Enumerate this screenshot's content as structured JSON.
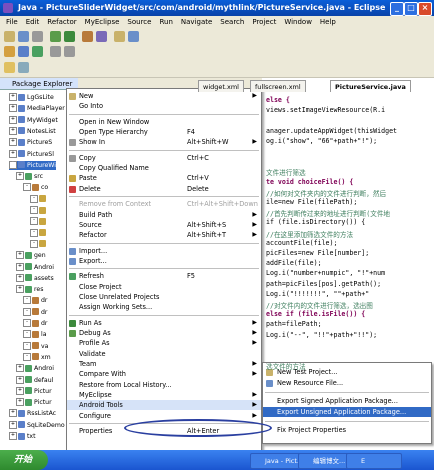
{
  "window": {
    "title": "Java - PictureSliderWidget/src/com/android/mythlink/PictureService.java - Eclipse",
    "minimize": "_",
    "maximize": "□",
    "close": "×"
  },
  "menubar": [
    "File",
    "Edit",
    "Refactor",
    "MyEclipse",
    "Source",
    "Run",
    "Navigate",
    "Search",
    "Project",
    "Window",
    "Help"
  ],
  "package_explorer": {
    "tab_label": "Package Explorer",
    "items": [
      {
        "label": "LgGsLite",
        "indent": 1
      },
      {
        "label": "MediaPlayer",
        "indent": 1
      },
      {
        "label": "MyWidget",
        "indent": 1
      },
      {
        "label": "NotesList",
        "indent": 1
      },
      {
        "label": "PictureS",
        "indent": 1
      },
      {
        "label": "PictureSl",
        "indent": 1
      },
      {
        "label": "PictureWi",
        "indent": 1,
        "selected": true
      },
      {
        "label": "src",
        "indent": 2
      },
      {
        "label": "co",
        "indent": 3
      },
      {
        "label": "",
        "indent": 4
      },
      {
        "label": "",
        "indent": 4
      },
      {
        "label": "",
        "indent": 4
      },
      {
        "label": "",
        "indent": 4
      },
      {
        "label": "",
        "indent": 4
      },
      {
        "label": "gen",
        "indent": 2
      },
      {
        "label": "Androi",
        "indent": 2
      },
      {
        "label": "assets",
        "indent": 2
      },
      {
        "label": "res",
        "indent": 2
      },
      {
        "label": "dr",
        "indent": 3
      },
      {
        "label": "dr",
        "indent": 3
      },
      {
        "label": "dr",
        "indent": 3
      },
      {
        "label": "la",
        "indent": 3
      },
      {
        "label": "va",
        "indent": 3
      },
      {
        "label": "xm",
        "indent": 3
      },
      {
        "label": "Androi",
        "indent": 2
      },
      {
        "label": "defaul",
        "indent": 2
      },
      {
        "label": "Pictur",
        "indent": 2
      },
      {
        "label": "Pictur",
        "indent": 2
      },
      {
        "label": "RssListAc",
        "indent": 1
      },
      {
        "label": "SqLiteDemo",
        "indent": 1
      },
      {
        "label": "txt",
        "indent": 1
      }
    ]
  },
  "editor_tabs": [
    {
      "label": "widget.xml"
    },
    {
      "label": "fullscreen.xml"
    },
    {
      "label": "PictureService.java",
      "active": true
    }
  ],
  "code_lines": [
    {
      "text": "else {",
      "style": "kw"
    },
    {
      "text": "views.setImageViewResource(R.i",
      "style": ""
    },
    {
      "text": "",
      "style": ""
    },
    {
      "text": "anager.updateAppWidget(thisWidget",
      "style": ""
    },
    {
      "text": "og.i(\"show\", \"66\"+path+\"!\");",
      "style": ""
    },
    {
      "text": "",
      "style": ""
    },
    {
      "text": "",
      "style": ""
    },
    {
      "text": "文件进行筛选",
      "style": "cmt"
    },
    {
      "text": "te void choiceFile() {",
      "style": "kw"
    },
    {
      "text": "//如何对文件夹内的文件进行判断，然后",
      "style": "cmt"
    },
    {
      "text": "ile=new File(filePath);",
      "style": ""
    },
    {
      "text": "//首先判断传过来的地址进行判断(文件地",
      "style": "cmt"
    },
    {
      "text": "if (file.isDirectory()) {",
      "style": ""
    },
    {
      "text": "  //在这里添加筛选文件的方法",
      "style": "cmt"
    },
    {
      "text": "  accountFile(file);",
      "style": ""
    },
    {
      "text": "  picFiles=new File[number];",
      "style": ""
    },
    {
      "text": "  addFile(file);",
      "style": ""
    },
    {
      "text": "  Log.i(\"number+numpic\", \"!\"+num",
      "style": ""
    },
    {
      "text": "  path=picFiles[pos].getPath();",
      "style": ""
    },
    {
      "text": "  Log.i(\"!!!!!!!\", \"\"+path+\"",
      "style": ""
    },
    {
      "text": "  //对文件内的文件进行筛选，选出图",
      "style": "cmt"
    },
    {
      "text": "else if (file.isFile()) {",
      "style": "kw"
    },
    {
      "text": "  path=filePath;",
      "style": ""
    },
    {
      "text": "  Log.i(\"--\", \"!!\"+path+\"!!\");",
      "style": ""
    },
    {
      "text": "",
      "style": ""
    },
    {
      "text": "",
      "style": ""
    },
    {
      "text": "选文件的方法",
      "style": "cmt"
    }
  ],
  "context_menu": {
    "items": [
      {
        "label": "New",
        "shortcut": "",
        "arrow": true
      },
      {
        "label": "Go Into",
        "shortcut": ""
      },
      {
        "sep": true
      },
      {
        "label": "Open in New Window",
        "shortcut": ""
      },
      {
        "label": "Open Type Hierarchy",
        "shortcut": "F4"
      },
      {
        "label": "Show In",
        "shortcut": "Alt+Shift+W",
        "arrow": true
      },
      {
        "sep": true
      },
      {
        "label": "Copy",
        "shortcut": "Ctrl+C"
      },
      {
        "label": "Copy Qualified Name",
        "shortcut": ""
      },
      {
        "label": "Paste",
        "shortcut": "Ctrl+V"
      },
      {
        "label": "Delete",
        "shortcut": "Delete"
      },
      {
        "sep": true
      },
      {
        "label": "Remove from Context",
        "shortcut": "Ctrl+Alt+Shift+Down",
        "disabled": true
      },
      {
        "label": "Build Path",
        "shortcut": "",
        "arrow": true
      },
      {
        "label": "Source",
        "shortcut": "Alt+Shift+S",
        "arrow": true
      },
      {
        "label": "Refactor",
        "shortcut": "Alt+Shift+T",
        "arrow": true
      },
      {
        "sep": true
      },
      {
        "label": "Import...",
        "shortcut": ""
      },
      {
        "label": "Export...",
        "shortcut": ""
      },
      {
        "sep": true
      },
      {
        "label": "Refresh",
        "shortcut": "F5"
      },
      {
        "label": "Close Project",
        "shortcut": ""
      },
      {
        "label": "Close Unrelated Projects",
        "shortcut": ""
      },
      {
        "label": "Assign Working Sets...",
        "shortcut": ""
      },
      {
        "sep": true
      },
      {
        "label": "Run As",
        "shortcut": "",
        "arrow": true
      },
      {
        "label": "Debug As",
        "shortcut": "",
        "arrow": true
      },
      {
        "label": "Profile As",
        "shortcut": "",
        "arrow": true
      },
      {
        "label": "Validate",
        "shortcut": ""
      },
      {
        "label": "Team",
        "shortcut": "",
        "arrow": true
      },
      {
        "label": "Compare With",
        "shortcut": "",
        "arrow": true
      },
      {
        "label": "Restore from Local History...",
        "shortcut": ""
      },
      {
        "label": "MyEclipse",
        "shortcut": "",
        "arrow": true
      },
      {
        "label": "Android Tools",
        "shortcut": "",
        "arrow": true,
        "highlighted": true
      },
      {
        "label": "Configure",
        "shortcut": "",
        "arrow": true
      },
      {
        "sep": true
      },
      {
        "label": "Properties",
        "shortcut": "Alt+Enter"
      }
    ]
  },
  "submenu": {
    "items": [
      {
        "label": "New Test Project..."
      },
      {
        "label": "New Resource File..."
      },
      {
        "sep": true
      },
      {
        "label": "Export Signed Application Package..."
      },
      {
        "label": "Export Unsigned Application Package...",
        "highlighted": true
      },
      {
        "sep": true
      },
      {
        "label": "Fix Project Properties"
      }
    ]
  },
  "taskbar": {
    "start": "开始",
    "tasks": [
      {
        "label": "Java - Pict..."
      },
      {
        "label": "编辑博文..."
      },
      {
        "label": "E"
      }
    ]
  },
  "colors": {
    "titlebar": "#0842a8",
    "menu_highlight": "#316ac5",
    "annotation": "#2a3fa0"
  }
}
